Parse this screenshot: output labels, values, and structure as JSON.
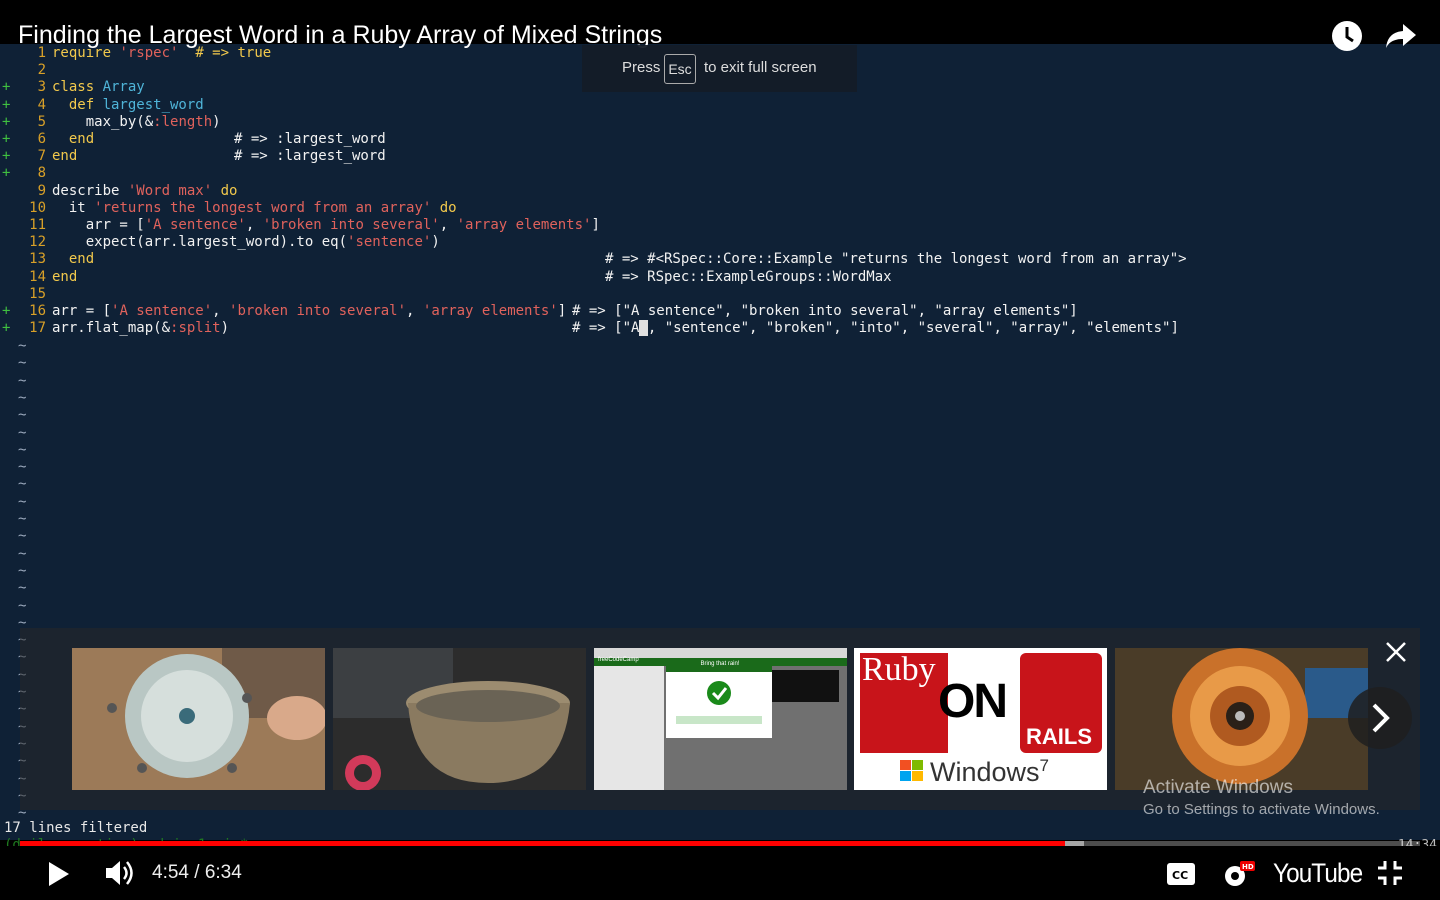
{
  "video": {
    "title": "Finding the Largest Word in a Ruby Array of Mixed Strings",
    "current_time": "4:54",
    "duration": "6:34",
    "progress": 0.7462,
    "buffered": 0.76,
    "time_display": "4:54 / 6:34",
    "brand": "YouTube"
  },
  "fullscreen_toast": {
    "press": "Press",
    "key": "Esc",
    "suffix": "to exit full screen"
  },
  "editor": {
    "lines": [
      {
        "n": "1",
        "mark": "",
        "segs": [
          [
            "k",
            "require "
          ],
          [
            "s",
            "'rspec'"
          ],
          [
            "w",
            "  "
          ],
          [
            "y",
            "# => true"
          ]
        ]
      },
      {
        "n": "2",
        "mark": "",
        "segs": []
      },
      {
        "n": "3",
        "mark": "+",
        "segs": [
          [
            "k",
            "class "
          ],
          [
            "c",
            "Array"
          ]
        ]
      },
      {
        "n": "4",
        "mark": "+",
        "segs": [
          [
            "k",
            "  def "
          ],
          [
            "c",
            "largest_word"
          ]
        ]
      },
      {
        "n": "5",
        "mark": "+",
        "segs": [
          [
            "w",
            "    max_by(&"
          ],
          [
            "s",
            ":length"
          ],
          [
            "w",
            ")"
          ]
        ]
      },
      {
        "n": "6",
        "mark": "+",
        "segs": [
          [
            "k",
            "  end"
          ]
        ]
      },
      {
        "n": "7",
        "mark": "+",
        "segs": [
          [
            "k",
            "end"
          ]
        ]
      },
      {
        "n": "8",
        "mark": "+",
        "segs": []
      },
      {
        "n": "9",
        "mark": "",
        "segs": [
          [
            "w",
            "describe "
          ],
          [
            "s",
            "'Word max'"
          ],
          [
            "k",
            " do"
          ]
        ]
      },
      {
        "n": "10",
        "mark": "",
        "segs": [
          [
            "w",
            "  it "
          ],
          [
            "s",
            "'returns the longest word from an array'"
          ],
          [
            "k",
            " do"
          ]
        ]
      },
      {
        "n": "11",
        "mark": "",
        "segs": [
          [
            "w",
            "    arr = ["
          ],
          [
            "s",
            "'A sentence'"
          ],
          [
            "w",
            ", "
          ],
          [
            "s",
            "'broken into several'"
          ],
          [
            "w",
            ", "
          ],
          [
            "s",
            "'array elements'"
          ],
          [
            "w",
            "]"
          ]
        ]
      },
      {
        "n": "12",
        "mark": "",
        "segs": [
          [
            "w",
            "    expect(arr.largest_word).to eq("
          ],
          [
            "s",
            "'sentence'"
          ],
          [
            "w",
            ")"
          ]
        ]
      },
      {
        "n": "13",
        "mark": "",
        "segs": [
          [
            "k",
            "  end"
          ]
        ]
      },
      {
        "n": "14",
        "mark": "",
        "segs": [
          [
            "k",
            "end"
          ]
        ]
      },
      {
        "n": "15",
        "mark": "",
        "segs": []
      },
      {
        "n": "16",
        "mark": "+",
        "segs": [
          [
            "w",
            "arr = ["
          ],
          [
            "s",
            "'A sentence'"
          ],
          [
            "w",
            ", "
          ],
          [
            "s",
            "'broken into several'"
          ],
          [
            "w",
            ", "
          ],
          [
            "s",
            "'array elements'"
          ],
          [
            "w",
            "]"
          ]
        ]
      },
      {
        "n": "17",
        "mark": "+",
        "segs": [
          [
            "w",
            "arr.flat_map(&"
          ],
          [
            "s",
            ":split"
          ],
          [
            "w",
            ")"
          ]
        ]
      }
    ],
    "comments": [
      {
        "line": 6,
        "col": 234,
        "text": "# => :largest_word"
      },
      {
        "line": 7,
        "col": 234,
        "text": "# => :largest_word"
      },
      {
        "line": 13,
        "col": 605,
        "text": "# => #<RSpec::Core::Example \"returns the longest word from an array\">"
      },
      {
        "line": 14,
        "col": 605,
        "text": "# => RSpec::ExampleGroups::WordMax"
      },
      {
        "line": 16,
        "col": 572,
        "text": "# => [\"A sentence\", \"broken into several\", \"array elements\"]"
      },
      {
        "line": 17,
        "col": 572,
        "text_before": "# => [\"A",
        "cursor": " ",
        "text_after": ", \"sentence\", \"broken\", \"into\", \"several\", \"array\", \"elements\"]"
      }
    ],
    "tilde": "~",
    "status": "17 lines filtered",
    "prompt": "(daily-practice) admin 1:vim*",
    "clock": "14:34"
  },
  "related": [
    {
      "label": "spinning disc video",
      "type": "photo1"
    },
    {
      "label": "metal bowl video",
      "type": "photo2"
    },
    {
      "label": "freeCodeCamp video",
      "caption": "Bring that rain!",
      "logo": "freeCodeCamp"
    },
    {
      "label": "Ruby on Rails Windows 7",
      "ruby": "Ruby",
      "on": "ON",
      "rails": "RAILS",
      "windows": "Windows",
      "seven": "7"
    },
    {
      "label": "copper coil video",
      "type": "photo3"
    }
  ],
  "watermark": {
    "line1": "Activate Windows",
    "line2": "Go to Settings to activate Windows."
  },
  "colors": {
    "accent": "#ff0000",
    "editor_bg": "#0f2136"
  }
}
